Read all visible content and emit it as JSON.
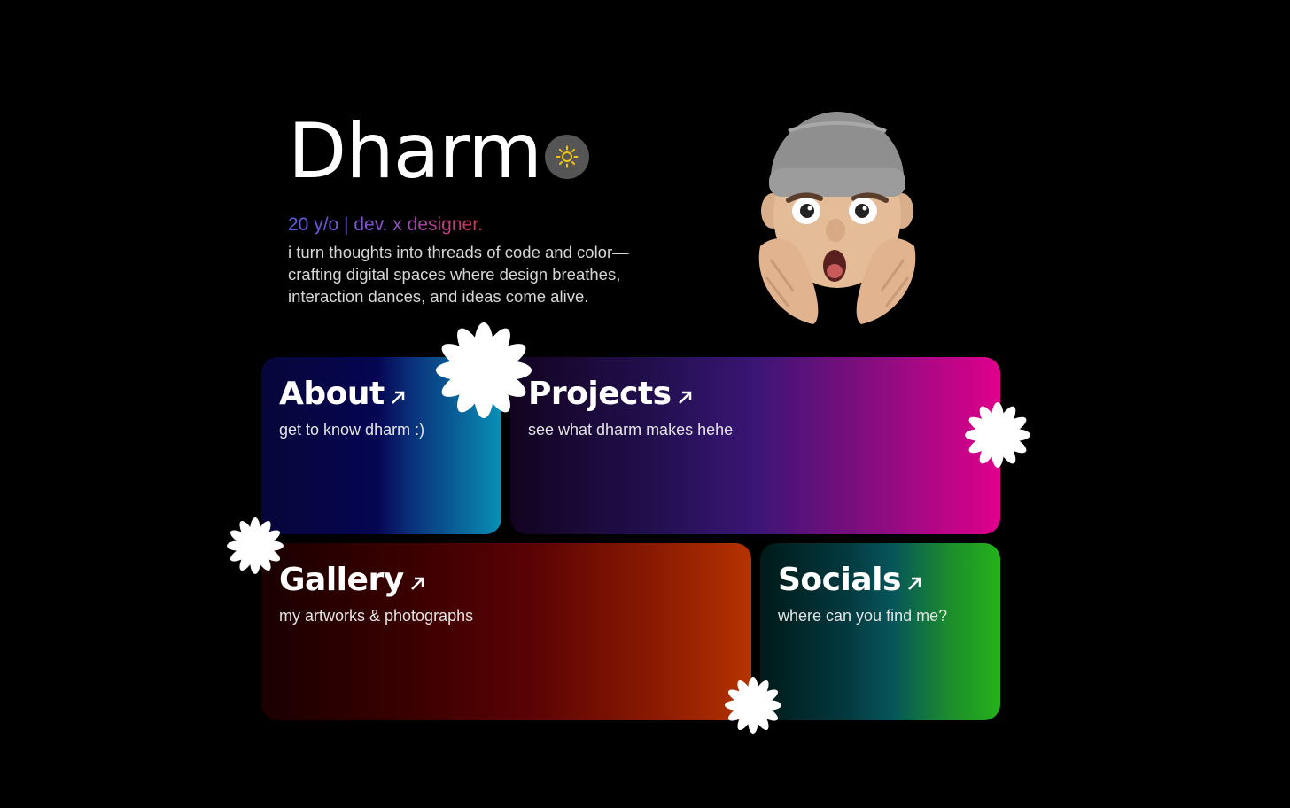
{
  "header": {
    "name": "Dharm",
    "tagline": "20 y/o | dev. x designer.",
    "bio": "i turn thoughts into threads of code and color—crafting digital spaces where design breathes, interaction dances, and ideas come alive."
  },
  "theme_toggle": {
    "icon": "sun-icon"
  },
  "avatar": {
    "icon": "shocked-memoji"
  },
  "cards": [
    {
      "title": "About",
      "subtitle": "get to know dharm :)"
    },
    {
      "title": "Projects",
      "subtitle": "see what dharm makes hehe"
    },
    {
      "title": "Gallery",
      "subtitle": "my artworks & photographs"
    },
    {
      "title": "Socials",
      "subtitle": "where can you find me?"
    }
  ],
  "colors": {
    "background": "#000000",
    "about": [
      "#050552",
      "#0890b5"
    ],
    "projects": [
      "#120320",
      "#e0008c"
    ],
    "gallery": [
      "#1a0000",
      "#b53300"
    ],
    "socials": [
      "#001a18",
      "#24b21a"
    ],
    "sun": "#f2c511"
  }
}
